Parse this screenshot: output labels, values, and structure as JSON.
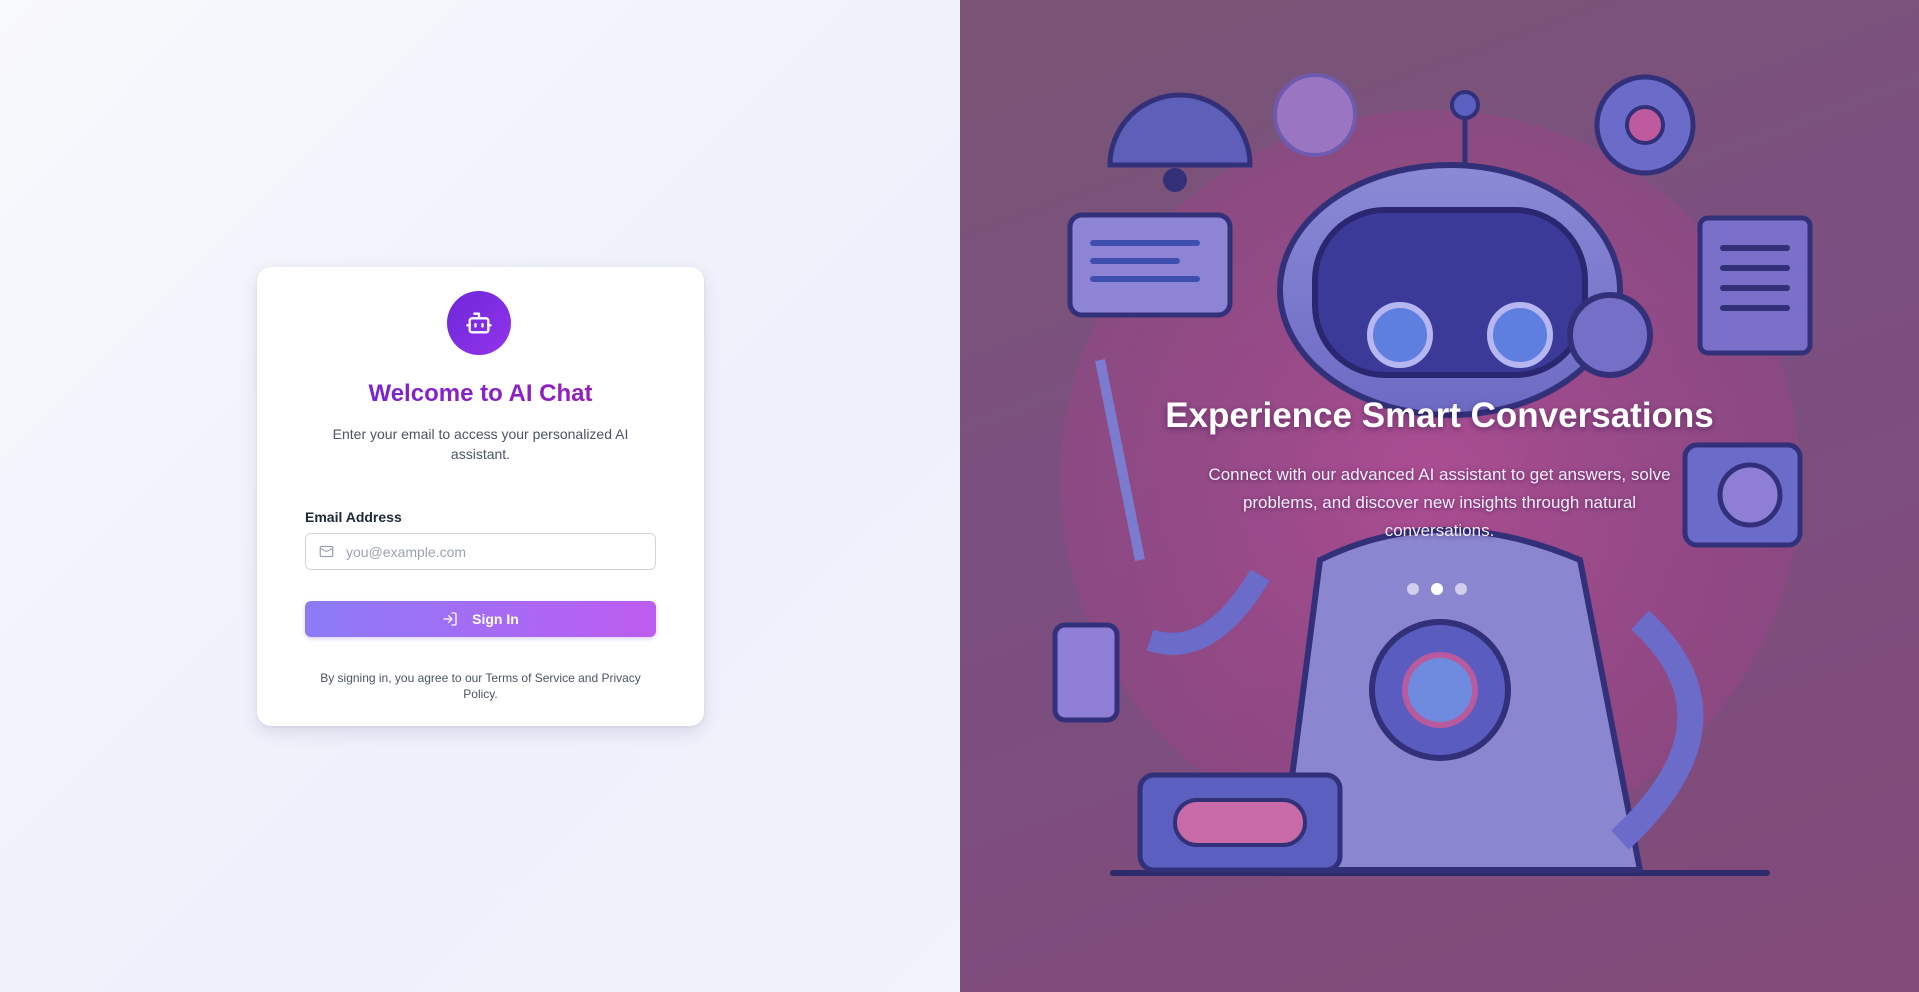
{
  "login": {
    "title": "Welcome to AI Chat",
    "subtitle": "Enter your email to access your personalized AI assistant.",
    "email_label": "Email Address",
    "email_placeholder": "you@example.com",
    "email_value": "",
    "signin_label": "Sign In",
    "terms_text": "By signing in, you agree to our Terms of Service and Privacy Policy."
  },
  "hero": {
    "title": "Experience Smart Conversations",
    "text": "Connect with our advanced AI assistant to get answers, solve problems, and discover new insights through natural conversations.",
    "slides": 3,
    "active_slide": 2
  },
  "icons": {
    "logo": "bot-icon",
    "email": "mail-icon",
    "signin": "log-in-icon"
  },
  "colors": {
    "brand_primary": "#6d28d9",
    "brand_secondary": "#9333ea",
    "button_start": "#8b7cf6",
    "button_end": "#bd5cf0",
    "hero_bg": "#7b4f80"
  }
}
